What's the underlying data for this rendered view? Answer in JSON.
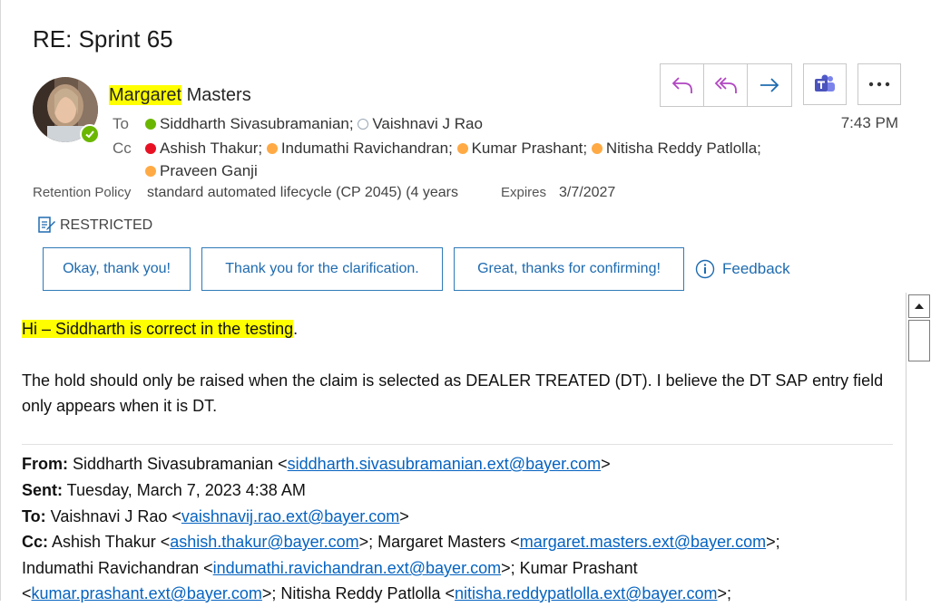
{
  "email": {
    "subject": "RE: Sprint 65",
    "sender_first": "Margaret",
    "sender_last": " Masters",
    "time": "7:43 PM",
    "to_label": "To",
    "cc_label": "Cc",
    "to": [
      {
        "name": "Siddharth Sivasubramanian;",
        "status": "green"
      },
      {
        "name": "Vaishnavi J Rao",
        "status": "offline"
      }
    ],
    "cc_line1": [
      {
        "name": "Ashish Thakur;",
        "status": "red"
      },
      {
        "name": "Indumathi Ravichandran;",
        "status": "away"
      },
      {
        "name": "Kumar Prashant;",
        "status": "away"
      },
      {
        "name": "Nitisha Reddy Patlolla;",
        "status": "away"
      }
    ],
    "cc_line2": [
      {
        "name": "Praveen Ganji",
        "status": "away"
      }
    ],
    "retention_label": "Retention Policy",
    "retention_value": "standard automated lifecycle (CP 2045) (4 years",
    "expires_label": "Expires",
    "expires_value": "3/7/2027",
    "sensitivity": "RESTRICTED"
  },
  "suggested_replies": [
    "Okay, thank you!",
    "Thank you for the clarification.",
    "Great, thanks for confirming!"
  ],
  "feedback_label": "Feedback",
  "body": {
    "line1_highlight": "Hi – Siddharth is correct in the testing",
    "line1_tail": ".",
    "para2": "The hold should only be raised when the claim is selected as DEALER TREATED (DT).  I believe the DT SAP entry field only appears when it is DT."
  },
  "quoted": {
    "from_label": "From:",
    "from_name": " Siddharth Sivasubramanian <",
    "from_email": "siddharth.sivasubramanian.ext@bayer.com",
    "from_end": ">",
    "sent_label": "Sent:",
    "sent_value": " Tuesday, March 7, 2023 4:38 AM",
    "to_label": "To:",
    "to_name": " Vaishnavi J Rao <",
    "to_email": "vaishnavij.rao.ext@bayer.com",
    "to_end": ">",
    "cc_label": "Cc:",
    "cc_1_name": " Ashish Thakur <",
    "cc_1_email": "ashish.thakur@bayer.com",
    "cc_2_name": ">; Margaret Masters <",
    "cc_2_email": "margaret.masters.ext@bayer.com",
    "cc_2_end": ">;",
    "cc_3_name": "Indumathi Ravichandran <",
    "cc_3_email": "indumathi.ravichandran.ext@bayer.com",
    "cc_4_name": ">; Kumar Prashant",
    "cc_5_open": "<",
    "cc_5_email": "kumar.prashant.ext@bayer.com",
    "cc_6_name": ">; Nitisha Reddy Patlolla <",
    "cc_6_email": "nitisha.reddypatlolla.ext@bayer.com",
    "cc_6_end": ">;"
  },
  "colors": {
    "accent": "#1e6bb0",
    "highlight": "#ffff00",
    "presence_available": "#6bb700",
    "presence_busy": "#e81123",
    "presence_away": "#ffaa44",
    "link": "#0563c1"
  },
  "icons": {
    "reply": "reply-icon",
    "reply_all": "reply-all-icon",
    "forward": "forward-icon",
    "teams": "teams-icon",
    "more": "more-icon",
    "sensitivity": "sensitivity-label-icon",
    "info": "info-icon"
  }
}
